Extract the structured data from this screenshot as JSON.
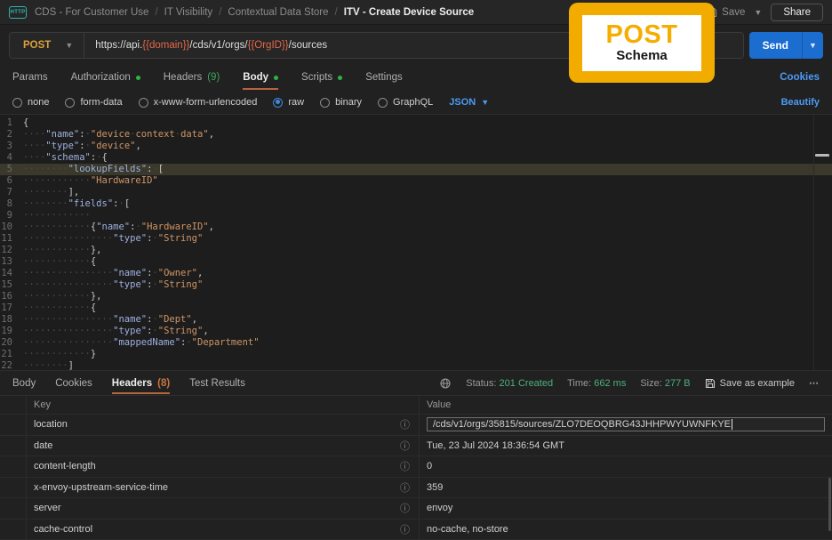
{
  "colors": {
    "badge_yellow": "#f2ac00",
    "method_yellow": "#dba03a",
    "variable_orange": "#e5684a",
    "send_blue": "#1c6dd0",
    "link_blue": "#4a9bf5",
    "success_green": "#4cb17c",
    "tab_dot_green": "#2fb344",
    "active_tab_underline": "#b4643e",
    "highlight_line_bg": "#3a392b"
  },
  "header": {
    "breadcrumb": [
      "CDS - For Customer Use",
      "IT Visibility",
      "Contextual Data Store",
      "ITV - Create Device Source"
    ],
    "save_label": "Save",
    "share_label": "Share",
    "icons": [
      "http-icon",
      "floppy-icon",
      "chevron-down-icon"
    ]
  },
  "request": {
    "method": "POST",
    "url_parts": [
      {
        "t": "plain",
        "v": "https://api."
      },
      {
        "t": "var",
        "v": "{{domain}}"
      },
      {
        "t": "plain",
        "v": "/cds/v1/orgs/"
      },
      {
        "t": "var",
        "v": "{{OrgID}}"
      },
      {
        "t": "plain",
        "v": "/sources"
      }
    ],
    "send_label": "Send"
  },
  "request_tabs": [
    {
      "label": "Params"
    },
    {
      "label": "Authorization",
      "dot": true
    },
    {
      "label": "Headers",
      "count": "(9)",
      "count_color": "green"
    },
    {
      "label": "Body",
      "dot": true,
      "active": true
    },
    {
      "label": "Scripts",
      "dot": true
    },
    {
      "label": "Settings"
    }
  ],
  "cookies_link": "Cookies",
  "body_modes": [
    {
      "label": "none"
    },
    {
      "label": "form-data"
    },
    {
      "label": "x-www-form-urlencoded"
    },
    {
      "label": "raw",
      "selected": true
    },
    {
      "label": "binary"
    },
    {
      "label": "GraphQL"
    }
  ],
  "language_selector": "JSON",
  "beautify_link": "Beautify",
  "editor": {
    "highlight_line": 5,
    "lines": [
      "{",
      "    \"name\": \"device context data\",",
      "    \"type\": \"device\",",
      "    \"schema\": {",
      "        \"lookupFields\": [",
      "            \"HardwareID\"",
      "        ],",
      "        \"fields\": [",
      "            ",
      "            {\"name\": \"HardwareID\",",
      "                \"type\": \"String\"",
      "            },",
      "            {",
      "                \"name\": \"Owner\",",
      "                \"type\": \"String\"",
      "            },",
      "            {",
      "                \"name\": \"Dept\",",
      "                \"type\": \"String\",",
      "                \"mappedName\": \"Department\"",
      "            }",
      "        ]"
    ]
  },
  "response": {
    "tabs": [
      {
        "label": "Body"
      },
      {
        "label": "Cookies"
      },
      {
        "label": "Headers",
        "count": "(8)",
        "active": true,
        "count_color": "orange"
      },
      {
        "label": "Test Results"
      }
    ],
    "status_label": "Status:",
    "status_value": "201 Created",
    "time_label": "Time:",
    "time_value": "662 ms",
    "size_label": "Size:",
    "size_value": "277 B",
    "save_example_label": "Save as example",
    "more_label": "⋯"
  },
  "headers_table": {
    "columns": [
      "Key",
      "Value"
    ],
    "rows": [
      {
        "key": "location",
        "value": "/cds/v1/orgs/35815/sources/ZLO7DEOQBRG43JHHPWYUWNFKYE",
        "editing": true
      },
      {
        "key": "date",
        "value": "Tue, 23 Jul 2024 18:36:54 GMT"
      },
      {
        "key": "content-length",
        "value": "0"
      },
      {
        "key": "x-envoy-upstream-service-time",
        "value": "359"
      },
      {
        "key": "server",
        "value": "envoy"
      },
      {
        "key": "cache-control",
        "value": "no-cache, no-store"
      }
    ]
  },
  "overlay_badge": {
    "title": "POST",
    "subtitle": "Schema"
  }
}
